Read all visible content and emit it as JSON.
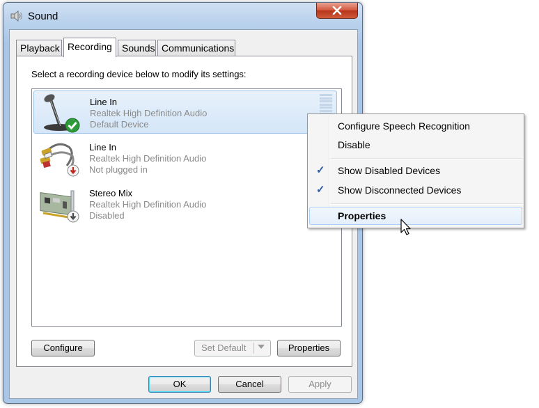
{
  "window": {
    "title": "Sound",
    "title_icon": "speaker-icon",
    "close_icon": "close-icon"
  },
  "tabs": [
    {
      "label": "Playback",
      "active": false
    },
    {
      "label": "Recording",
      "active": true
    },
    {
      "label": "Sounds",
      "active": false
    },
    {
      "label": "Communications",
      "active": false
    }
  ],
  "panel": {
    "instruction": "Select a recording device below to modify its settings:"
  },
  "devices": [
    {
      "name": "Line In",
      "driver": "Realtek High Definition Audio",
      "status": "Default Device",
      "icon": "microphone-icon",
      "badge": "default-check-icon",
      "selected": true
    },
    {
      "name": "Line In",
      "driver": "Realtek High Definition Audio",
      "status": "Not plugged in",
      "icon": "rca-cable-icon",
      "badge": "unplugged-arrow-icon",
      "selected": false
    },
    {
      "name": "Stereo Mix",
      "driver": "Realtek High Definition Audio",
      "status": "Disabled",
      "icon": "sound-card-icon",
      "badge": "disabled-arrow-icon",
      "selected": false
    }
  ],
  "panel_buttons": {
    "configure": "Configure",
    "set_default": "Set Default",
    "properties": "Properties"
  },
  "dialog_buttons": {
    "ok": "OK",
    "cancel": "Cancel",
    "apply": "Apply"
  },
  "context_menu": {
    "items": [
      {
        "label": "Configure Speech Recognition",
        "checked": false
      },
      {
        "label": "Disable",
        "checked": false
      },
      {
        "label": "Show Disabled Devices",
        "checked": true
      },
      {
        "label": "Show Disconnected Devices",
        "checked": true
      },
      {
        "label": "Properties",
        "checked": false,
        "bold": true,
        "hover": true
      }
    ],
    "check_glyph": "✓"
  },
  "colors": {
    "selection": "#d4e6f8",
    "default_check": "#2e9b3a",
    "status_gray": "#8a8a8a"
  }
}
